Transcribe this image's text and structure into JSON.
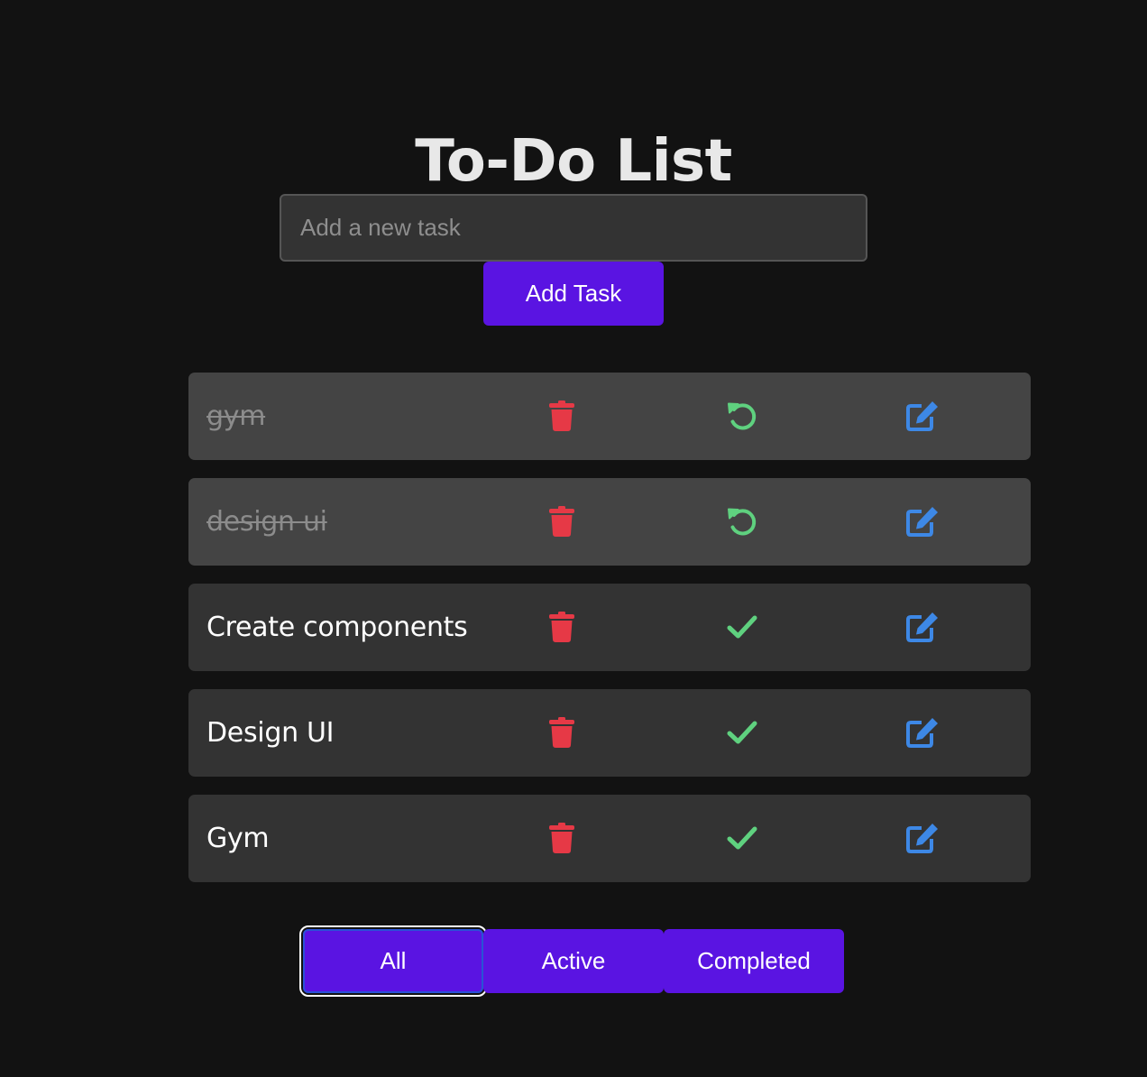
{
  "header": {
    "title": "To-Do List"
  },
  "new_task": {
    "placeholder": "Add a new task",
    "value": "",
    "add_label": "Add Task"
  },
  "tasks": [
    {
      "text": "gym",
      "completed": true,
      "toggle_icon": "undo-icon"
    },
    {
      "text": "design ui",
      "completed": true,
      "toggle_icon": "undo-icon"
    },
    {
      "text": "Create components",
      "completed": false,
      "toggle_icon": "check-icon"
    },
    {
      "text": "Design UI",
      "completed": false,
      "toggle_icon": "check-icon"
    },
    {
      "text": "Gym",
      "completed": false,
      "toggle_icon": "check-icon"
    }
  ],
  "filters": {
    "selected": "All",
    "all_label": "All",
    "active_label": "Active",
    "completed_label": "Completed"
  },
  "colors": {
    "background": "#121212",
    "accent": "#5a14e2",
    "delete": "#e63946",
    "complete": "#5fd17f",
    "edit": "#3d88e6",
    "row": "#333333",
    "row_completed": "#444444"
  },
  "icons": {
    "delete": "trash-icon",
    "edit": "edit-icon"
  }
}
